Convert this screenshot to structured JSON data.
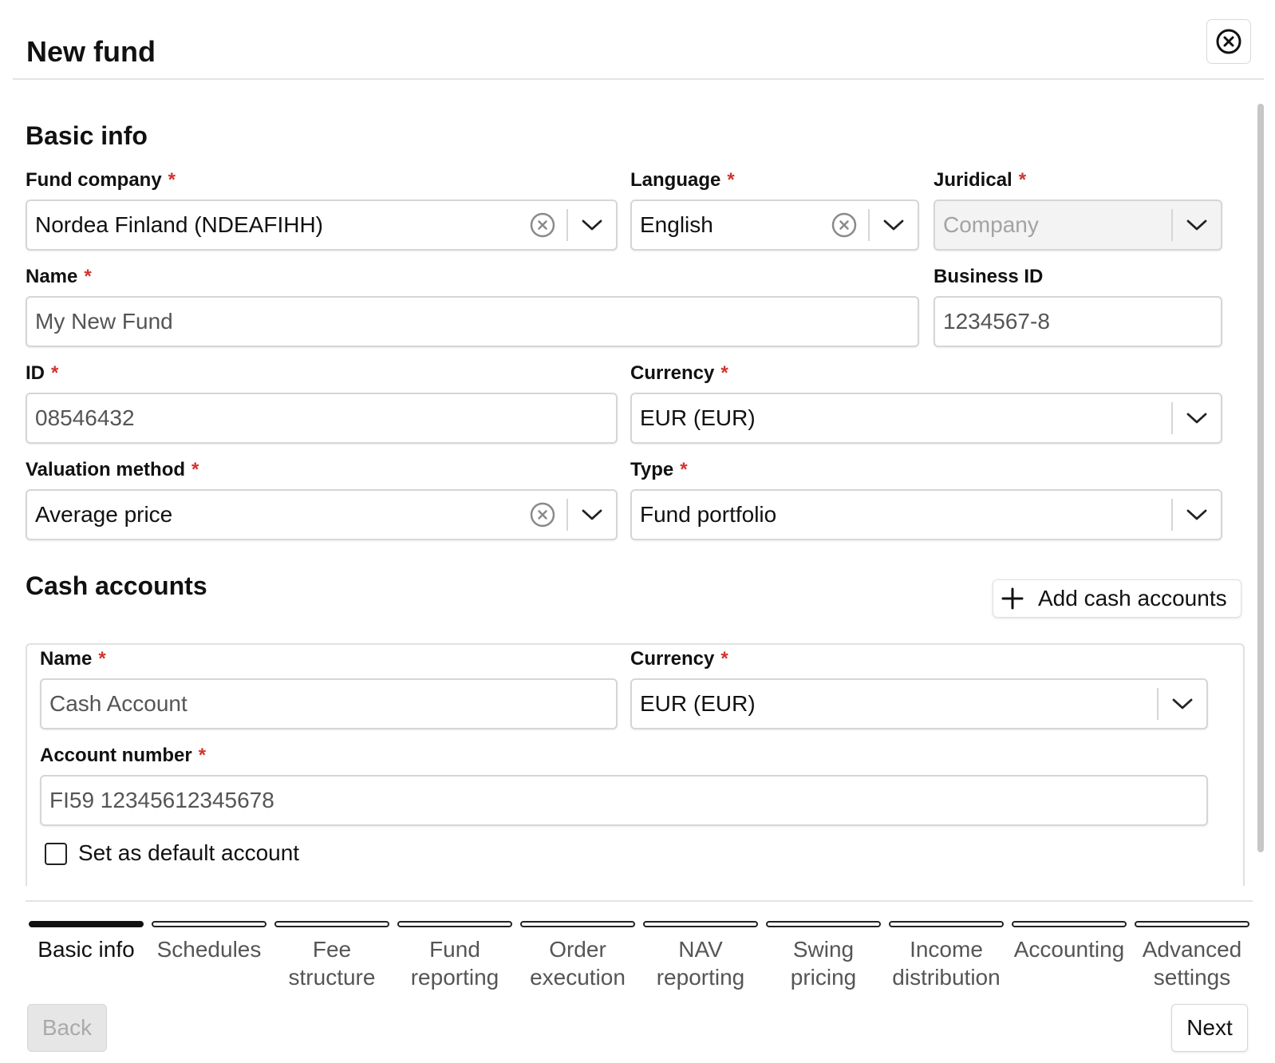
{
  "dialog": {
    "title": "New fund"
  },
  "basic_info": {
    "title": "Basic info",
    "fund_company": {
      "label": "Fund company",
      "required": "*",
      "value": "Nordea Finland (NDEAFIHH)"
    },
    "language": {
      "label": "Language",
      "required": "*",
      "value": "English"
    },
    "juridical": {
      "label": "Juridical",
      "required": "*",
      "placeholder": "Company"
    },
    "name": {
      "label": "Name",
      "required": "*",
      "value": "My New Fund"
    },
    "business_id": {
      "label": "Business ID",
      "value": "1234567-8"
    },
    "id": {
      "label": "ID",
      "required": "*",
      "value": "08546432"
    },
    "currency": {
      "label": "Currency",
      "required": "*",
      "value": "EUR (EUR)"
    },
    "valuation_method": {
      "label": "Valuation method",
      "required": "*",
      "value": "Average price"
    },
    "type": {
      "label": "Type",
      "required": "*",
      "value": "Fund portfolio"
    }
  },
  "cash_accounts": {
    "title": "Cash accounts",
    "add_button": "Add cash accounts",
    "account": {
      "name": {
        "label": "Name",
        "required": "*",
        "value": "Cash Account"
      },
      "currency": {
        "label": "Currency",
        "required": "*",
        "value": "EUR (EUR)"
      },
      "account_number": {
        "label": "Account number",
        "required": "*",
        "value": "FI59 12345612345678"
      },
      "default_checkbox": {
        "label": "Set as default account",
        "checked": false
      }
    }
  },
  "steps": [
    {
      "line1": "Basic info",
      "line2": "",
      "active": true
    },
    {
      "line1": "Schedules",
      "line2": ""
    },
    {
      "line1": "Fee",
      "line2": "structure"
    },
    {
      "line1": "Fund",
      "line2": "reporting"
    },
    {
      "line1": "Order",
      "line2": "execution"
    },
    {
      "line1": "NAV",
      "line2": "reporting"
    },
    {
      "line1": "Swing",
      "line2": "pricing"
    },
    {
      "line1": "Income",
      "line2": "distribution"
    },
    {
      "line1": "Accounting",
      "line2": ""
    },
    {
      "line1": "Advanced",
      "line2": "settings"
    }
  ],
  "footer": {
    "back": "Back",
    "next": "Next"
  },
  "colors": {
    "required": "#d0342c",
    "border": "#d6d6d6",
    "active_step": "#111111",
    "disabled_bg": "#e6e6e6"
  },
  "icons": {
    "close": "close-circle-icon",
    "clear": "clear-circle-icon",
    "dropdown": "chevron-down-icon",
    "add": "plus-icon"
  }
}
